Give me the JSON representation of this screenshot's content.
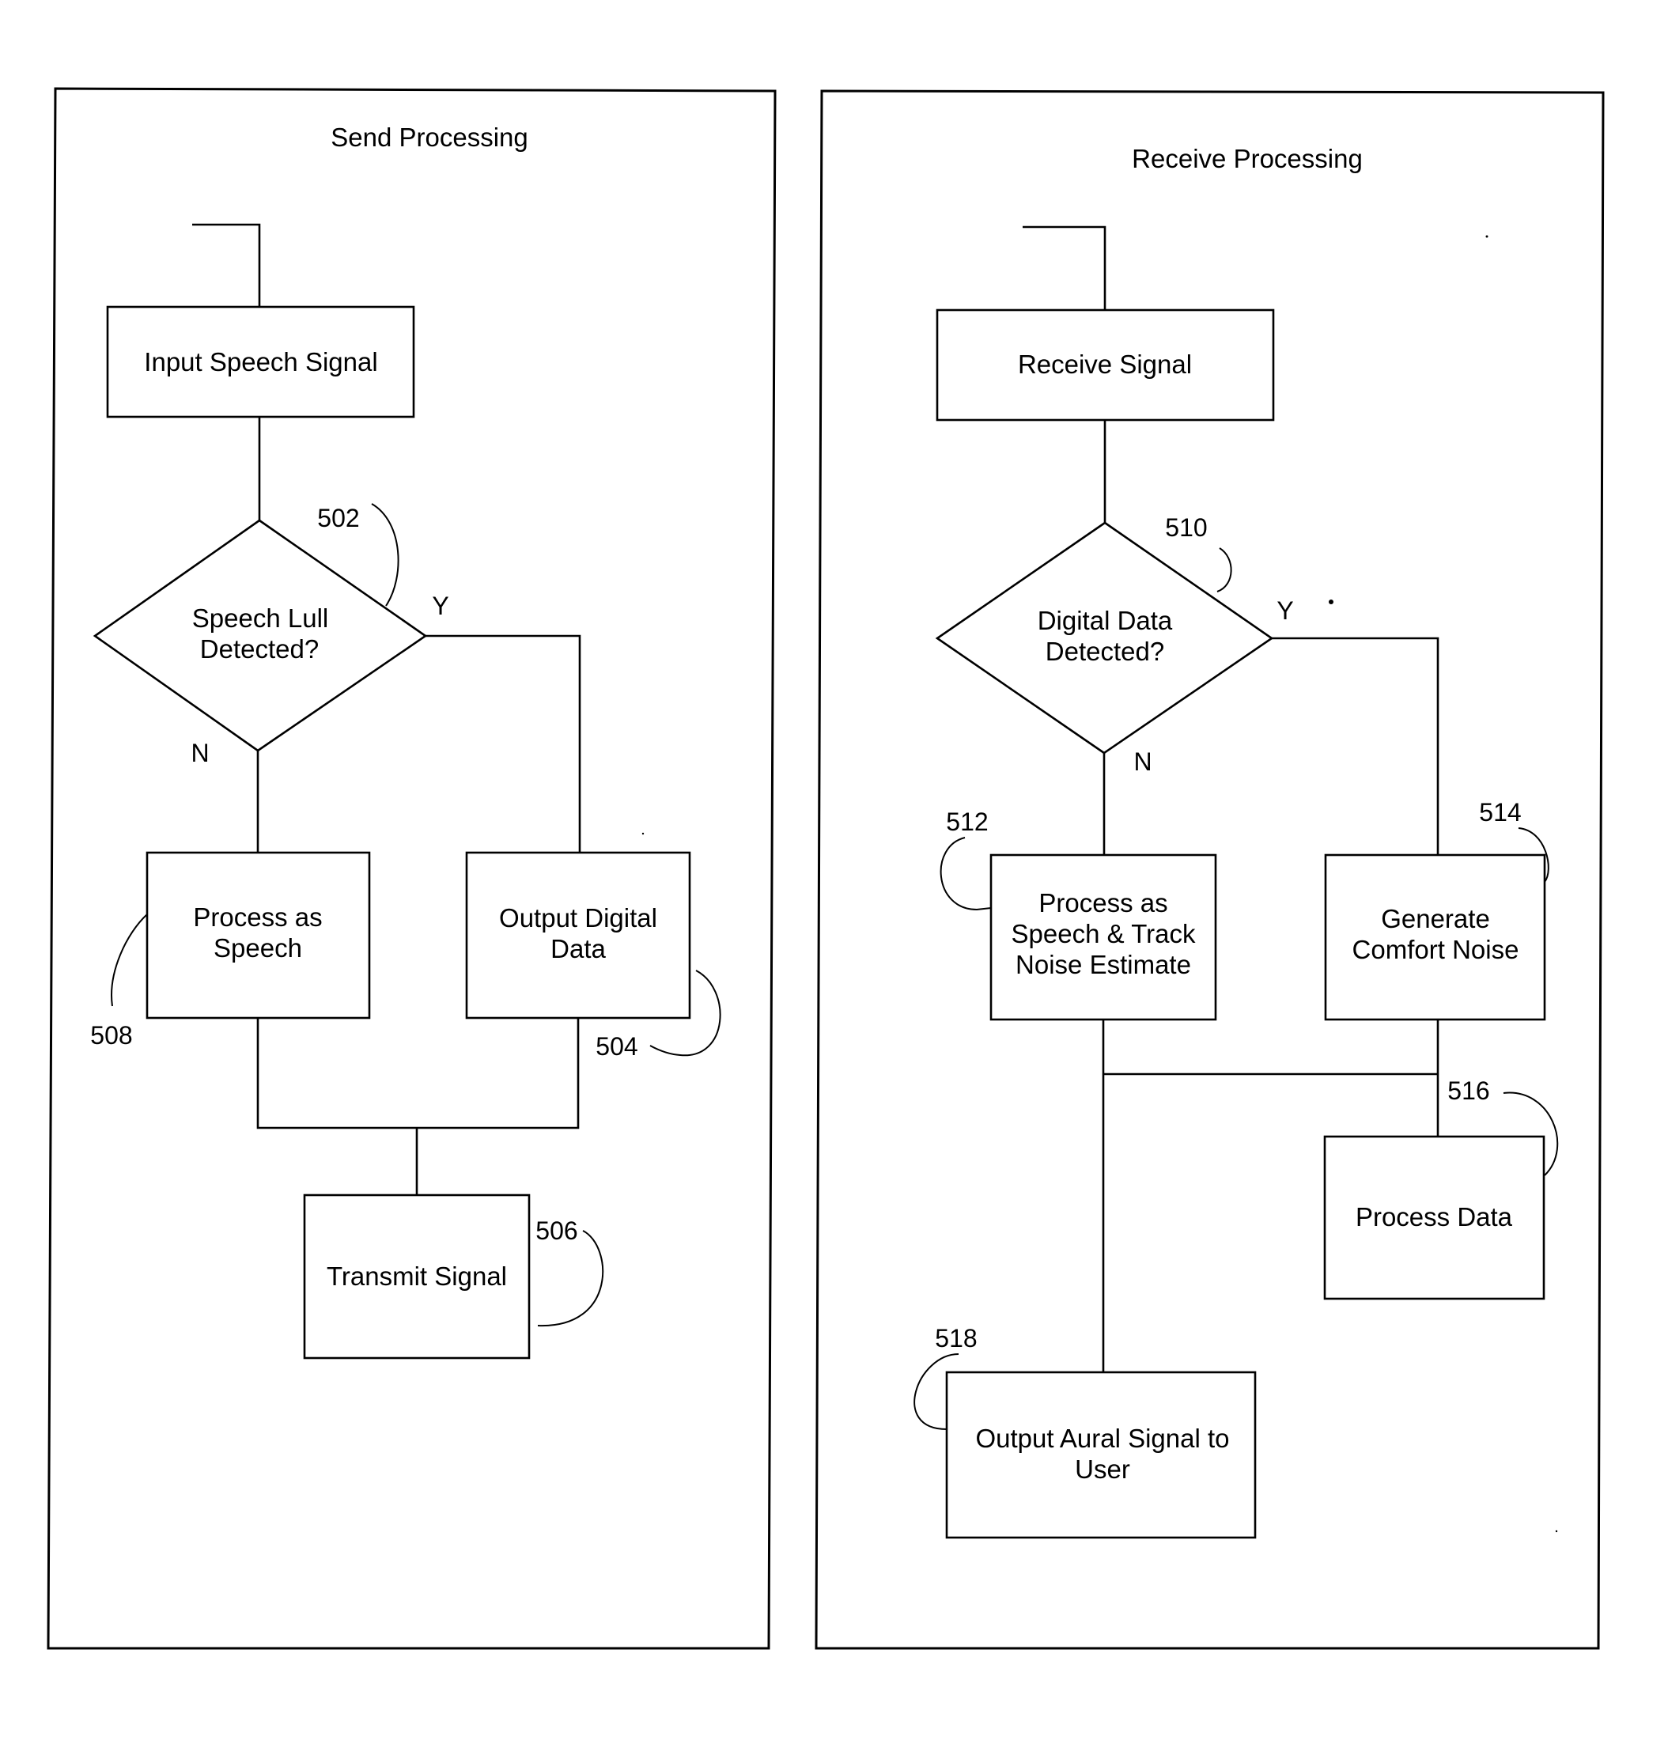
{
  "panels": {
    "send": {
      "title": "Send Processing",
      "steps": {
        "input": {
          "lines": [
            "Input Speech Signal"
          ]
        },
        "decision": {
          "lines": [
            "Speech Lull",
            "Detected?"
          ],
          "ref": "502",
          "yes": "Y",
          "no": "N"
        },
        "speech": {
          "lines": [
            "Process as",
            "Speech"
          ],
          "ref": "508"
        },
        "digital": {
          "lines": [
            "Output Digital",
            "Data"
          ],
          "ref": "504"
        },
        "transmit": {
          "lines": [
            "Transmit Signal"
          ],
          "ref": "506"
        }
      }
    },
    "receive": {
      "title": "Receive Processing",
      "steps": {
        "receive": {
          "lines": [
            "Receive Signal"
          ]
        },
        "decision": {
          "lines": [
            "Digital Data",
            "Detected?"
          ],
          "ref": "510",
          "yes": "Y",
          "no": "N"
        },
        "speech": {
          "lines": [
            "Process as",
            "Speech & Track",
            "Noise Estimate"
          ],
          "ref": "512"
        },
        "comfort": {
          "lines": [
            "Generate",
            "Comfort Noise"
          ],
          "ref": "514"
        },
        "data": {
          "lines": [
            "Process Data"
          ],
          "ref": "516"
        },
        "output": {
          "lines": [
            "Output Aural Signal to",
            "User"
          ],
          "ref": "518"
        }
      }
    }
  }
}
